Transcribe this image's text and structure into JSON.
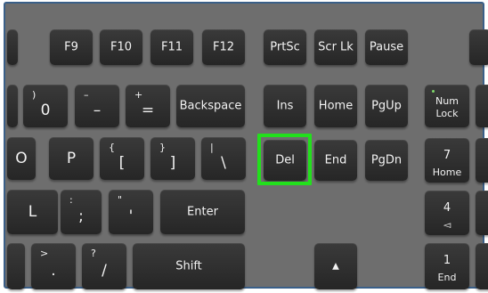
{
  "keyboard": {
    "function_row": {
      "f9": "F9",
      "f10": "F10",
      "f11": "F11",
      "f12": "F12",
      "prtsc": "PrtSc",
      "scrlk": "Scr Lk",
      "pause": "Pause"
    },
    "number_row": {
      "zero_top": ")",
      "zero": "0",
      "minus_top": "–",
      "minus": "–",
      "equals_top": "+",
      "equals": "=",
      "backspace": "Backspace"
    },
    "nav_cluster": {
      "ins": "Ins",
      "home": "Home",
      "pgup": "PgUp",
      "del": "Del",
      "end": "End",
      "pgdn": "PgDn",
      "up_arrow": "▲"
    },
    "qwerty_row": {
      "o": "O",
      "p": "P",
      "lbracket_top": "{",
      "lbracket": "[",
      "rbracket_top": "}",
      "rbracket": "]",
      "backslash_top": "|",
      "backslash": "\\"
    },
    "home_row": {
      "l": "L",
      "semicolon_top": ":",
      "semicolon": ";",
      "quote_top": "\"",
      "quote": "'",
      "enter": "Enter"
    },
    "bottom_row": {
      "period_top": ">",
      "period": ".",
      "slash_top": "?",
      "slash": "/",
      "shift": "Shift"
    },
    "numpad": {
      "numlock_line1": "Num",
      "numlock_line2": "Lock",
      "seven": "7",
      "seven_sub": "Home",
      "four": "4",
      "four_sub": "◅",
      "one": "1",
      "one_sub": "End"
    },
    "highlight_color": "#22e01c"
  }
}
